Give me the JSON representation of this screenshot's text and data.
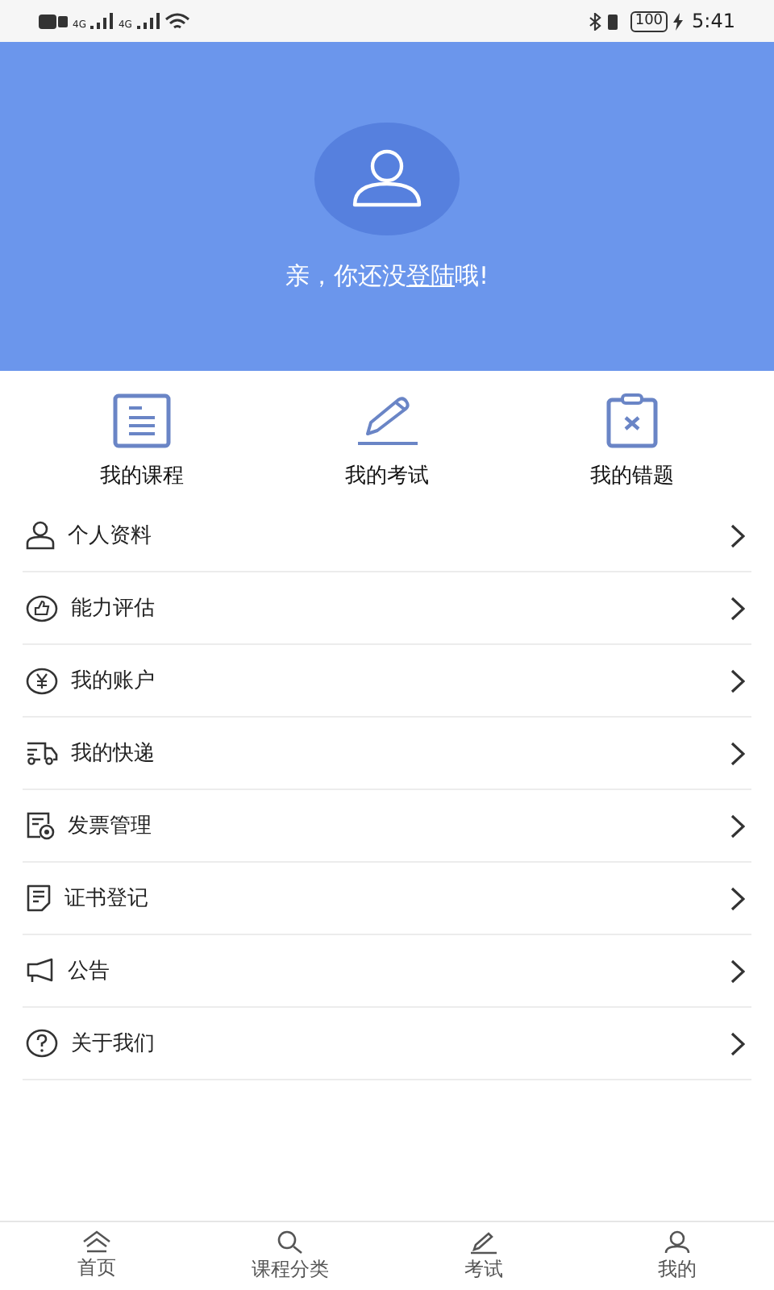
{
  "status_bar": {
    "network_1": "4G",
    "network_2": "4G",
    "battery": "100",
    "time": "5:41"
  },
  "header": {
    "greeting_before": "亲，你还没",
    "login_link": "登陆",
    "greeting_after": "哦!"
  },
  "shortcuts": [
    {
      "kind": "course",
      "label": "我的课程"
    },
    {
      "kind": "exam",
      "label": "我的考试"
    },
    {
      "kind": "mistakes",
      "label": "我的错题"
    }
  ],
  "menu": [
    {
      "kind": "profile",
      "label": "个人资料"
    },
    {
      "kind": "ability",
      "label": "能力评估"
    },
    {
      "kind": "account",
      "label": "我的账户"
    },
    {
      "kind": "delivery",
      "label": "我的快递"
    },
    {
      "kind": "invoice",
      "label": "发票管理"
    },
    {
      "kind": "certificate",
      "label": "证书登记"
    },
    {
      "kind": "notice",
      "label": "公告"
    },
    {
      "kind": "about",
      "label": "关于我们"
    }
  ],
  "tab_bar": [
    {
      "kind": "home",
      "label": "首页",
      "selected": false
    },
    {
      "kind": "search",
      "label": "课程分类",
      "selected": false
    },
    {
      "kind": "exam",
      "label": "考试",
      "selected": false
    },
    {
      "kind": "user",
      "label": "我的",
      "selected": false
    }
  ]
}
